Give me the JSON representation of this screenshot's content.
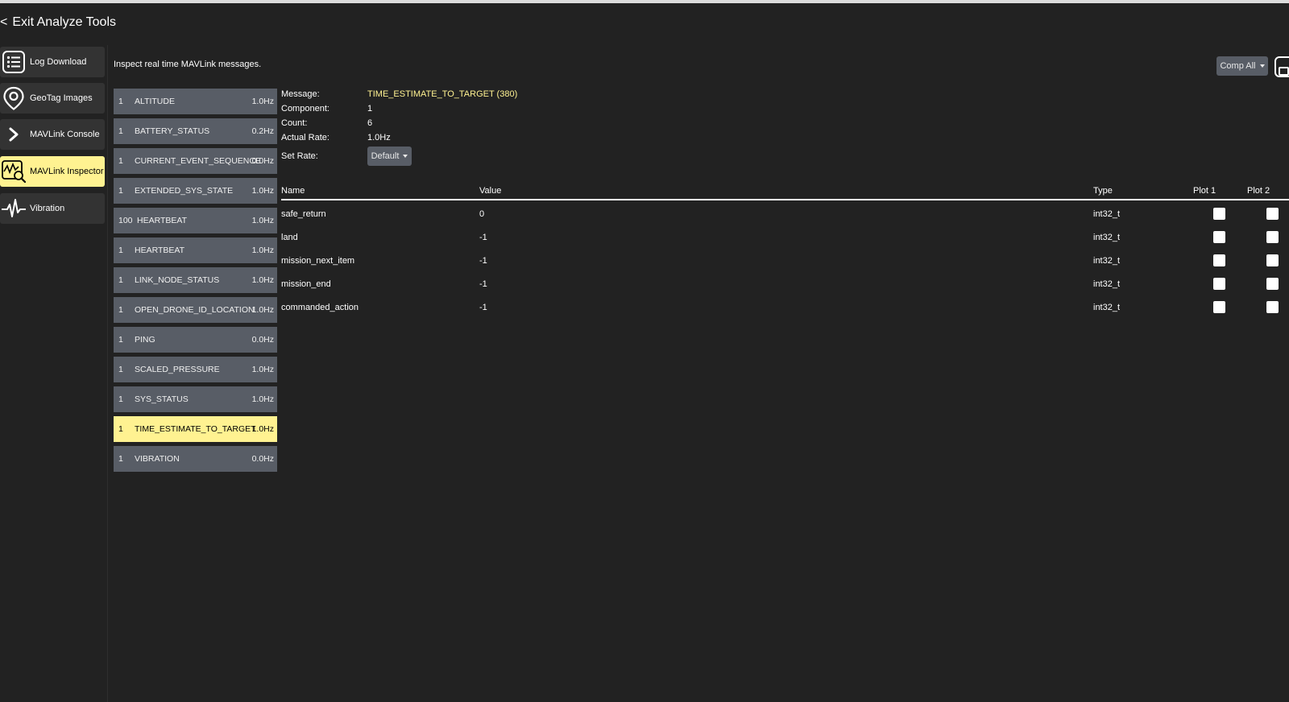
{
  "header": {
    "exit_chevron": "<",
    "exit_label": "Exit Analyze Tools"
  },
  "sidebar": {
    "items": [
      {
        "label": "Log Download",
        "icon": "list-icon"
      },
      {
        "label": "GeoTag Images",
        "icon": "map-pin-icon"
      },
      {
        "label": "MAVLink Console",
        "icon": "chevron-right-icon"
      },
      {
        "label": "MAVLink Inspector",
        "icon": "chart-search-icon",
        "active": true
      },
      {
        "label": "Vibration",
        "icon": "waveform-icon"
      }
    ]
  },
  "main": {
    "description": "Inspect real time MAVLink messages.",
    "comp_select": {
      "label": "Comp All"
    }
  },
  "messages": [
    {
      "sys": "1",
      "name": "ALTITUDE",
      "rate": "1.0Hz"
    },
    {
      "sys": "1",
      "name": "BATTERY_STATUS",
      "rate": "0.2Hz"
    },
    {
      "sys": "1",
      "name": "CURRENT_EVENT_SEQUENCE",
      "rate": "0.0Hz"
    },
    {
      "sys": "1",
      "name": "EXTENDED_SYS_STATE",
      "rate": "1.0Hz"
    },
    {
      "sys": "100",
      "name": "HEARTBEAT",
      "rate": "1.0Hz"
    },
    {
      "sys": "1",
      "name": "HEARTBEAT",
      "rate": "1.0Hz"
    },
    {
      "sys": "1",
      "name": "LINK_NODE_STATUS",
      "rate": "1.0Hz"
    },
    {
      "sys": "1",
      "name": "OPEN_DRONE_ID_LOCATION",
      "rate": "1.0Hz"
    },
    {
      "sys": "1",
      "name": "PING",
      "rate": "0.0Hz"
    },
    {
      "sys": "1",
      "name": "SCALED_PRESSURE",
      "rate": "1.0Hz"
    },
    {
      "sys": "1",
      "name": "SYS_STATUS",
      "rate": "1.0Hz"
    },
    {
      "sys": "1",
      "name": "TIME_ESTIMATE_TO_TARGET",
      "rate": "1.0Hz",
      "active": true
    },
    {
      "sys": "1",
      "name": "VIBRATION",
      "rate": "0.0Hz"
    }
  ],
  "details": {
    "message_label": "Message:",
    "message_value": "TIME_ESTIMATE_TO_TARGET (380)",
    "component_label": "Component:",
    "component_value": "1",
    "count_label": "Count:",
    "count_value": "6",
    "rate_label": "Actual Rate:",
    "rate_value": "1.0Hz",
    "set_rate_label": "Set Rate:",
    "set_rate_value": "Default"
  },
  "table": {
    "headers": {
      "name": "Name",
      "value": "Value",
      "type": "Type",
      "plot1": "Plot 1",
      "plot2": "Plot 2"
    },
    "rows": [
      {
        "name": "safe_return",
        "value": "0",
        "type": "int32_t",
        "plot1": false,
        "plot2": false
      },
      {
        "name": "land",
        "value": "-1",
        "type": "int32_t",
        "plot1": false,
        "plot2": false
      },
      {
        "name": "mission_next_item",
        "value": "-1",
        "type": "int32_t",
        "plot1": false,
        "plot2": false
      },
      {
        "name": "mission_end",
        "value": "-1",
        "type": "int32_t",
        "plot1": false,
        "plot2": false
      },
      {
        "name": "commanded_action",
        "value": "-1",
        "type": "int32_t",
        "plot1": false,
        "plot2": false
      }
    ]
  },
  "colors": {
    "background": "#222222",
    "accent": "#fff291",
    "row_bg": "#585d66",
    "nav_bg": "#333333"
  }
}
